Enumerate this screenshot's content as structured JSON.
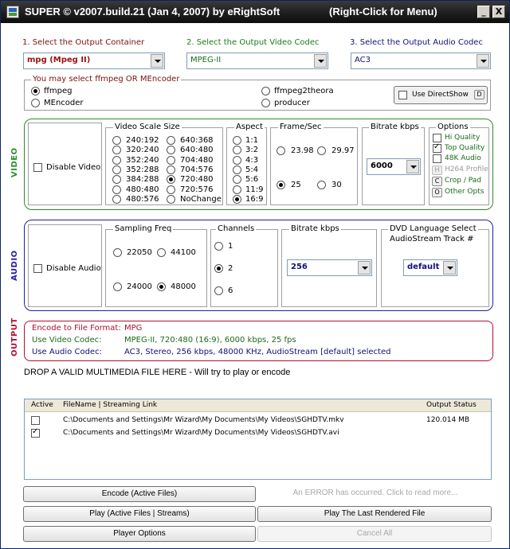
{
  "window": {
    "title": "SUPER © v2007.build.21 (Jan 4, 2007) by eRightSoft",
    "menu_hint": "(Right-Click for Menu)",
    "minimize": "_",
    "close": "X"
  },
  "steps": {
    "container_label": "1.       Select the Output Container",
    "video_codec_label": "2.       Select the Output Video Codec",
    "audio_codec_label": "3.       Select the Output Audio Codec",
    "container_value": "mpg  (Mpeg II)",
    "video_codec_value": "MPEG-II",
    "audio_codec_value": "AC3"
  },
  "encoder": {
    "title": "You may select ffmpeg OR MEncoder",
    "options": [
      "ffmpeg",
      "MEncoder",
      "ffmpeg2theora",
      "producer"
    ],
    "selected": "ffmpeg",
    "directshow_label": "Use DirectShow",
    "directshow_key": "D"
  },
  "video": {
    "section_label": "VIDEO",
    "disable_label": "Disable Video",
    "scale_title": "Video Scale Size",
    "scale_col1": [
      "240:192",
      "320:240",
      "352:240",
      "352:288",
      "384:288",
      "480:480",
      "480:576"
    ],
    "scale_col2": [
      "640:368",
      "640:480",
      "704:480",
      "704:576",
      "720:480",
      "720:576",
      "NoChange"
    ],
    "scale_selected": "720:480",
    "aspect_title": "Aspect",
    "aspect": [
      "1:1",
      "3:2",
      "4:3",
      "5:4",
      "5:6",
      "11:9",
      "16:9"
    ],
    "aspect_selected": "16:9",
    "fps_title": "Frame/Sec",
    "fps": [
      "23.98",
      "29.97",
      "25",
      "30"
    ],
    "fps_selected": "25",
    "bitrate_title": "Bitrate  kbps",
    "bitrate_value": "6000",
    "options_title": "Options",
    "options": [
      {
        "label": "Hi Quality",
        "checked": false
      },
      {
        "label": "Top Quality",
        "checked": true
      },
      {
        "label": "48K Audio",
        "checked": false
      }
    ],
    "option_buttons": [
      {
        "key": "H",
        "label": "H264 Profile"
      },
      {
        "key": "C",
        "label": "Crop / Pad"
      },
      {
        "key": "O",
        "label": "Other Opts"
      }
    ]
  },
  "audio": {
    "section_label": "AUDIO",
    "disable_label": "Disable Audio",
    "sampling_title": "Sampling Freq",
    "sampling": [
      "22050",
      "44100",
      "24000",
      "48000"
    ],
    "sampling_selected": "48000",
    "channels_title": "Channels",
    "channels": [
      "1",
      "2",
      "6"
    ],
    "channels_selected": "2",
    "bitrate_title": "Bitrate  kbps",
    "bitrate_value": "256",
    "dvd_title": "DVD Language Select",
    "dvd_subtitle": "AudioStream  Track #",
    "dvd_value": "default"
  },
  "output": {
    "section_label": "OUTPUT",
    "rows": [
      {
        "label": "Encode to File Format:",
        "value": "MPG"
      },
      {
        "label": "Use Video Codec:",
        "value": "MPEG-II,  720:480 (16:9),  6000 kbps,  25 fps"
      },
      {
        "label": "Use Audio Codec:",
        "value": "AC3,  Stereo,  256 kbps,  48000 KHz,  AudioStream [default] selected"
      }
    ]
  },
  "drop_text": "DROP A VALID MULTIMEDIA FILE HERE - Will try to play or encode",
  "filelist": {
    "headers": [
      "Active",
      "FileName  |  Streaming Link",
      "Output Status"
    ],
    "rows": [
      {
        "active": false,
        "name": "C:\\Documents and Settings\\Mr Wizard\\My Documents\\My Videos\\SGHDTV.mkv",
        "status": "120.014 MB"
      },
      {
        "active": true,
        "name": "C:\\Documents and Settings\\Mr Wizard\\My Documents\\My Videos\\SGHDTV.avi",
        "status": ""
      }
    ]
  },
  "buttons": {
    "encode": "Encode (Active Files)",
    "error": "An ERROR has occurred. Click to read more...",
    "play": "Play (Active Files | Streams)",
    "play_last": "Play The Last Rendered File",
    "player_options": "Player Options",
    "cancel_all": "Cancel All"
  },
  "colors": {
    "video_border": "#2e8b2e",
    "audio_border": "#2020a0",
    "output_border": "#b01030",
    "output_label": "#b01030",
    "output_value": "#1010a0"
  }
}
